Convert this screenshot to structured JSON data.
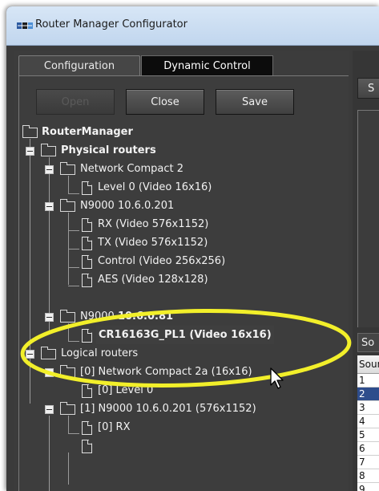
{
  "window": {
    "title": "Router Manager Configurator"
  },
  "tabs": [
    {
      "label": "Configuration"
    },
    {
      "label": "Dynamic Control"
    }
  ],
  "toolbar": {
    "open_label": "Open",
    "close_label": "Close",
    "save_label": "Save"
  },
  "tree": {
    "root": "RouterManager",
    "physical": "Physical routers",
    "nc2": "Network Compact 2",
    "nc2_level0": "Level 0 (Video 16x16)",
    "n9000_201": "N9000 10.6.0.201",
    "rx": "RX (Video 576x1152)",
    "tx": "TX (Video 576x1152)",
    "control": "Control (Video 256x256)",
    "aes": "AES (Video 128x128)",
    "n9000_81_prefix": "N9000",
    "n9000_81_ip": "10.6.0.81",
    "cr": "CR16163G_PL1 (Video 16x16)",
    "logical": "Logical routers",
    "lnc2a": "[0] Network Compact 2a (16x16)",
    "lnc2a_level0": "[0] Level 0",
    "ln9000": "[1] N9000 10.6.0.201 (576x1152)",
    "ln9000_rx": "[0] RX"
  },
  "right": {
    "tab_label": "S",
    "tab2_label": "So",
    "table_header": "Sour",
    "rows": [
      "1",
      "2",
      "3",
      "4",
      "5",
      "6",
      "7",
      "8",
      "9"
    ]
  },
  "colors": {
    "highlight": "#f2ef2a",
    "selection_row": "#2e4d8c"
  }
}
